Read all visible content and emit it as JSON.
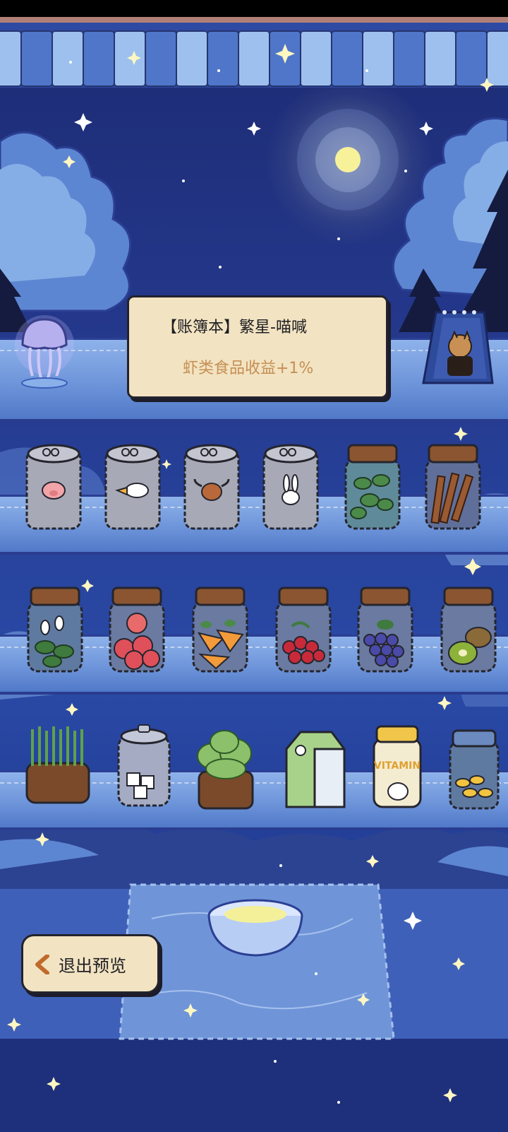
{
  "tooltip": {
    "title": "【账簿本】繁星-喵喊",
    "effect": "虾类食品收益+1%"
  },
  "exit_button": {
    "label": "退出预览",
    "icon": "chevron-left-icon"
  },
  "shelves": [
    {
      "row": "top",
      "items": [
        "jellyfish-lamp",
        "cat-poster-calendar"
      ]
    },
    {
      "row": "row-1",
      "items": [
        "pig-can",
        "duck-can",
        "cow-can",
        "rabbit-can",
        "mint-jar",
        "cinnamon-jar"
      ]
    },
    {
      "row": "row-2",
      "items": [
        "flower-jar",
        "strawberry-jar",
        "carrot-jar",
        "cherry-jar",
        "grape-jar",
        "kiwi-jar"
      ]
    },
    {
      "row": "row-3",
      "items": [
        "wheatgrass-pot",
        "sugar-cube-jar",
        "lettuce-pot",
        "milk-carton",
        "vitamin-bottle",
        "cheese-jar"
      ]
    }
  ],
  "colors": {
    "sky": "#24388c",
    "shelf": "#7aa0e0",
    "panel": "#f2e3c2",
    "effect_text": "#c68f54",
    "outline": "#23232e"
  }
}
